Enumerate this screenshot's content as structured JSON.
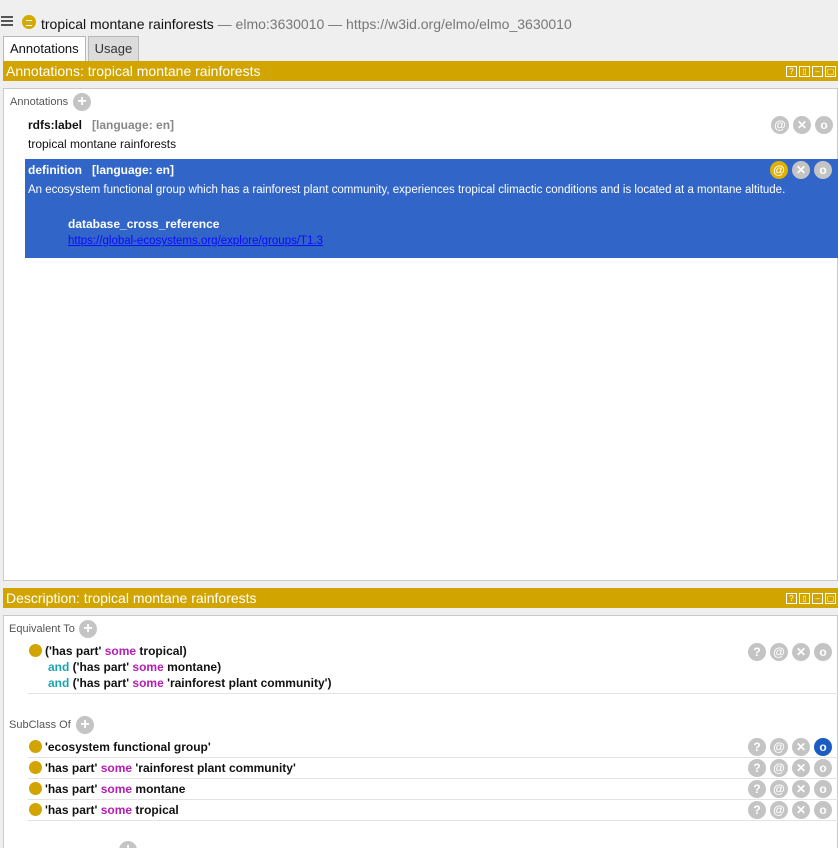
{
  "window": {
    "entity_name": "tropical montane rainforests",
    "entity_meta": " — elmo:3630010 — https://w3id.org/elmo/elmo_3630010"
  },
  "tabs": [
    {
      "label": "Annotations",
      "active": true
    },
    {
      "label": "Usage",
      "active": false
    }
  ],
  "annotations_panel": {
    "header": "Annotations: tropical montane rainforests",
    "section_label": "Annotations",
    "items": [
      {
        "property": "rdfs:label",
        "language": "[language: en]",
        "value": "tropical montane rainforests"
      },
      {
        "property": "definition",
        "language": "[language: en]",
        "value": "An ecosystem functional group which has a rainforest plant community, experiences tropical climactic conditions and is located at a montane altitude.",
        "nested_property": "database_cross_reference",
        "nested_value": "https://global-ecosystems.org/explore/groups/T1.3"
      }
    ]
  },
  "description_panel": {
    "header": "Description: tropical montane rainforests",
    "equivalent_label": "Equivalent To",
    "equivalent": {
      "line1": {
        "open": "('has part' ",
        "kw": "some",
        "rest": " tropical)"
      },
      "line2": {
        "and": "and",
        "open": " ('has part' ",
        "kw": "some",
        "rest": " montane)"
      },
      "line3": {
        "and": "and",
        "open": " ('has part' ",
        "kw": "some",
        "rest": " 'rainforest plant community')"
      }
    },
    "subclass_label": "SubClass Of",
    "subclasses": [
      {
        "text": "'ecosystem functional group'"
      },
      {
        "open": "'has part' ",
        "kw": "some",
        "rest": " 'rainforest plant community'"
      },
      {
        "open": "'has part' ",
        "kw": "some",
        "rest": " montane"
      },
      {
        "open": "'has part' ",
        "kw": "some",
        "rest": " tropical"
      }
    ]
  },
  "icons": {
    "help": "?",
    "annotate": "@",
    "delete": "✕",
    "edit": "o",
    "add": "+"
  },
  "colors": {
    "header": "#d1a400",
    "selection": "#3165c8",
    "keyword_some": "#b41db4",
    "keyword_and": "#1ca3b5"
  }
}
